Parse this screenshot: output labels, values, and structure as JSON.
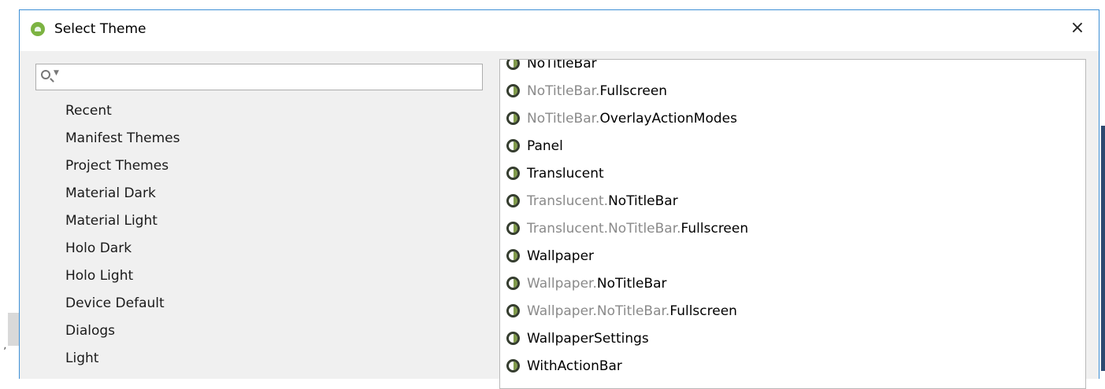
{
  "dialog": {
    "title": "Select Theme",
    "close_symbol": "×"
  },
  "search": {
    "value": "",
    "placeholder": ""
  },
  "categories": [
    "Recent",
    "Manifest Themes",
    "Project Themes",
    "Material Dark",
    "Material Light",
    "Holo Dark",
    "Holo Light",
    "Device Default",
    "Dialogs",
    "Light"
  ],
  "themes": [
    {
      "prefix": "",
      "name": "NoTitleBar"
    },
    {
      "prefix": "NoTitleBar.",
      "name": "Fullscreen"
    },
    {
      "prefix": "NoTitleBar.",
      "name": "OverlayActionModes"
    },
    {
      "prefix": "",
      "name": "Panel"
    },
    {
      "prefix": "",
      "name": "Translucent"
    },
    {
      "prefix": "Translucent.",
      "name": "NoTitleBar"
    },
    {
      "prefix": "Translucent.NoTitleBar.",
      "name": "Fullscreen"
    },
    {
      "prefix": "",
      "name": "Wallpaper"
    },
    {
      "prefix": "Wallpaper.",
      "name": "NoTitleBar"
    },
    {
      "prefix": "Wallpaper.NoTitleBar.",
      "name": "Fullscreen"
    },
    {
      "prefix": "",
      "name": "WallpaperSettings"
    },
    {
      "prefix": "",
      "name": "WithActionBar"
    }
  ],
  "icons": {
    "app": "android-studio-icon",
    "search": "search-icon",
    "theme": "theme-icon",
    "close": "close-icon"
  },
  "colors": {
    "accent_border": "#3c8fd6",
    "prefix_text": "#8a8a8a"
  }
}
